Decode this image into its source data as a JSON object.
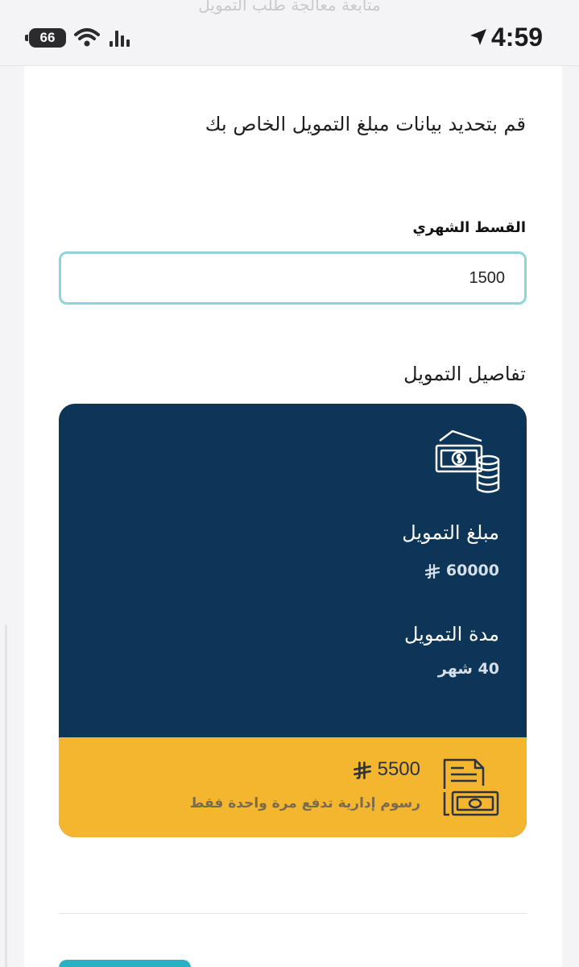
{
  "header_behind": "متابعة معالجة طلب التمويل",
  "status_bar": {
    "battery_level": "66",
    "time": "4:59"
  },
  "form": {
    "intro": "قم بتحديد بيانات مبلغ التمويل الخاص بك",
    "installment_label": "القسط الشهري",
    "installment_value": "1500"
  },
  "details": {
    "title": "تفاصيل التمويل",
    "amount_label": "مبلغ التمويل",
    "amount_value": "60000",
    "duration_label": "مدة التمويل",
    "duration_value": "40 شهر",
    "fee_value": "5500",
    "fee_note": "رسوم إدارية تدفع مرة واحدة فقط"
  },
  "icons": {
    "money": "money-stack-icon",
    "invoice": "invoice-icon",
    "currency": "riyal-icon"
  },
  "colors": {
    "card_background": "#0c3557",
    "fee_band": "#f4b52f",
    "input_border": "#8fd3dc",
    "button": "#27b2c3"
  }
}
